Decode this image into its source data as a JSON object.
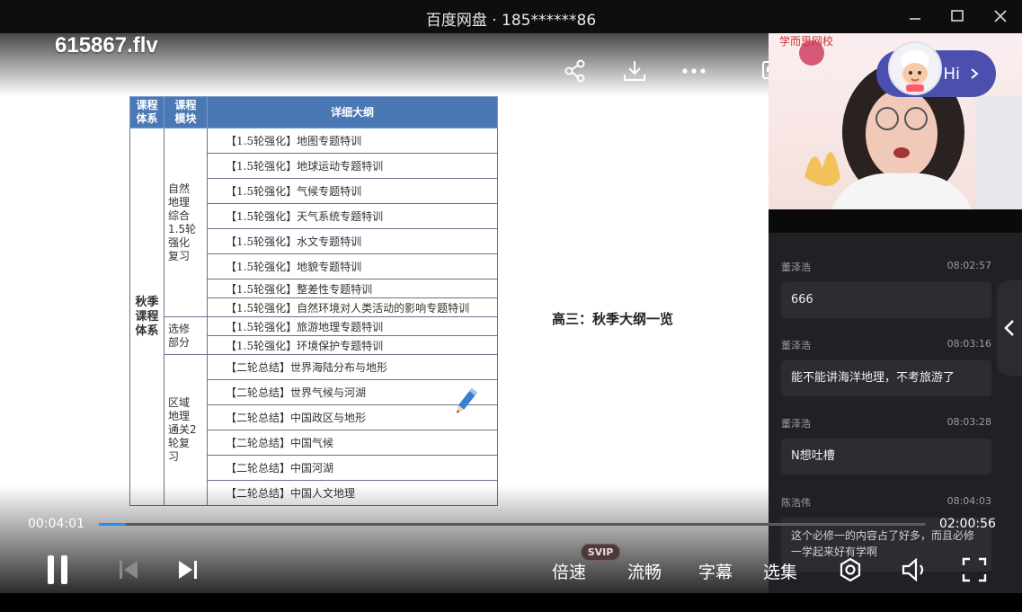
{
  "window": {
    "title": "百度网盘 · 185******86",
    "minimize_icon": "minimize-icon",
    "maximize_icon": "maximize-icon",
    "close_icon": "close-icon"
  },
  "video": {
    "filename": "615867.flv",
    "actions": [
      "share-icon",
      "download-icon",
      "more-icon",
      "picture-in-picture-icon",
      "float-window-icon"
    ]
  },
  "slide": {
    "headers": [
      "课程\n体系",
      "课程\n模块",
      "详细大纲"
    ],
    "system": "秋季\n课程\n体系",
    "modules": [
      {
        "name": "自然\n地理\n综合\n1.5轮\n强化\n复习",
        "rows": [
          "【1.5轮强化】地图专题特训",
          "【1.5轮强化】地球运动专题特训",
          "【1.5轮强化】气候专题特训",
          "【1.5轮强化】天气系统专题特训",
          "【1.5轮强化】水文专题特训",
          "【1.5轮强化】地貌专题特训",
          "【1.5轮强化】整差性专题特训",
          "【1.5轮强化】自然环境对人类活动的影响专题特训"
        ]
      },
      {
        "name": "选修\n部分",
        "rows": [
          "【1.5轮强化】旅游地理专题特训",
          "【1.5轮强化】环境保护专题特训"
        ]
      },
      {
        "name": "区域\n地理\n通关2\n轮复\n习",
        "rows": [
          "【二轮总结】世界海陆分布与地形",
          "【二轮总结】世界气候与河湖",
          "【二轮总结】中国政区与地形",
          "【二轮总结】中国气候",
          "【二轮总结】中国河湖",
          "【二轮总结】中国人文地理"
        ]
      }
    ],
    "note": "高三：秋季大纲一览"
  },
  "presenter": {
    "brand_text": "学而思网校",
    "hi_label": "Hi"
  },
  "chat": {
    "messages": [
      {
        "user": "董泽浩",
        "time": "08:02:57",
        "text": "666"
      },
      {
        "user": "董泽浩",
        "time": "08:03:16",
        "text": "能不能讲海洋地理，不考旅游了"
      },
      {
        "user": "董泽浩",
        "time": "08:03:28",
        "text": "N想吐槽"
      },
      {
        "user": "陈浩伟",
        "time": "08:04:03",
        "text": "这个必修一的内容占了好多，而且必修一学起来好有学啊"
      }
    ]
  },
  "player": {
    "current_time": "00:04:01",
    "total_time": "02:00:56",
    "progress": 0.033,
    "speed_label": "倍速",
    "svip_badge": "SVIP",
    "quality_label": "流畅",
    "subtitle_label": "字幕",
    "episodes_label": "选集",
    "accent_color": "#2a8df0"
  }
}
